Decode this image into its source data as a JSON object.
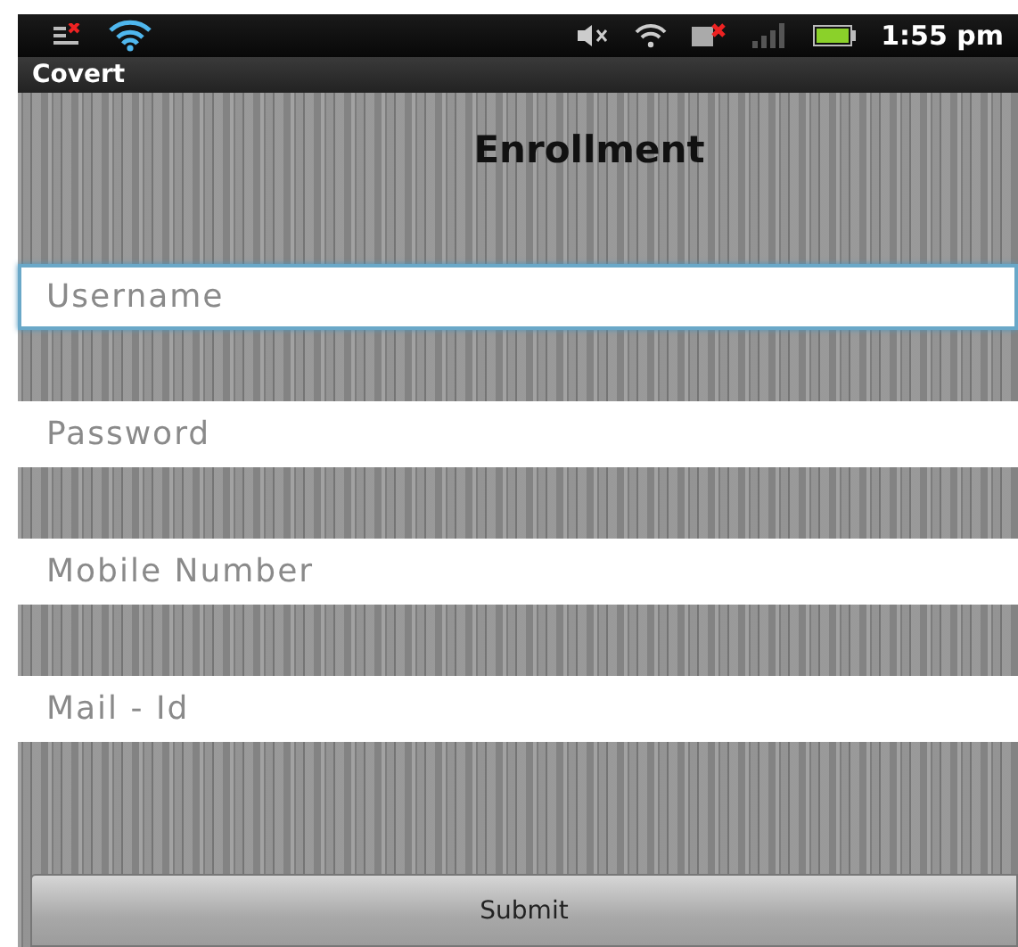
{
  "status_bar": {
    "time": "1:55 pm"
  },
  "app_bar": {
    "title": "Covert"
  },
  "heading": "Enrollment",
  "fields": [
    {
      "placeholder": "Username",
      "focused": true
    },
    {
      "placeholder": "Password",
      "focused": false
    },
    {
      "placeholder": "Mobile Number",
      "focused": false
    },
    {
      "placeholder": "Mail - Id",
      "focused": false
    }
  ],
  "submit_button": "Submit"
}
